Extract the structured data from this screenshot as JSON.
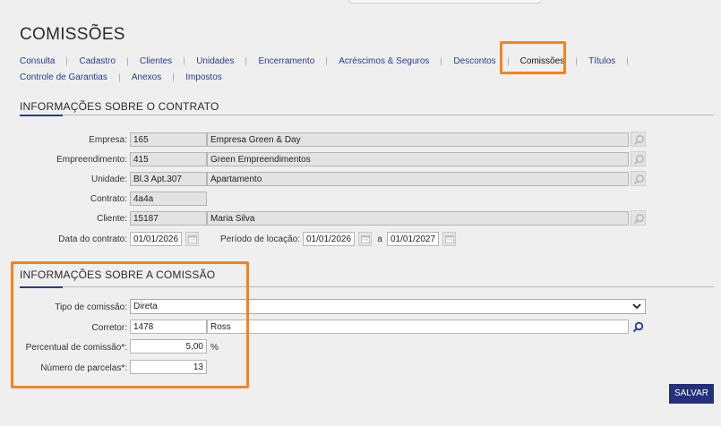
{
  "page": {
    "title": "COMISSÕES"
  },
  "tabs": {
    "row1": [
      "Consulta",
      "Cadastro",
      "Clientes",
      "Unidades",
      "Encerramento",
      "Acréscimos & Seguros",
      "Descontos",
      "Comissões",
      "Títulos"
    ],
    "row2": [
      "Controle de Garantias",
      "Anexos",
      "Impostos"
    ],
    "active": "Comissões"
  },
  "contract": {
    "title": "INFORMAÇÕES SOBRE O CONTRATO",
    "empresa": {
      "label": "Empresa:",
      "code": "165",
      "name": "Empresa Green & Day"
    },
    "empreendimento": {
      "label": "Empreendimento:",
      "code": "415",
      "name": "Green Empreendimentos"
    },
    "unidade": {
      "label": "Unidade:",
      "code": "Bl.3 Apt.307",
      "name": "Apartamento"
    },
    "contrato": {
      "label": "Contrato:",
      "code": "4a4a"
    },
    "cliente": {
      "label": "Cliente:",
      "code": "15187",
      "name": "Maria Silva"
    },
    "data_contrato": {
      "label": "Data do contrato:",
      "value": "01/01/2026"
    },
    "periodo": {
      "label": "Período de locação:",
      "start": "01/01/2026",
      "sep": "a",
      "end": "01/01/2027"
    }
  },
  "commission": {
    "title": "INFORMAÇÕES SOBRE A COMISSÃO",
    "tipo": {
      "label": "Tipo de comissão:",
      "value": "Direta"
    },
    "corretor": {
      "label": "Corretor:",
      "code": "1478",
      "name": "Ross"
    },
    "percentual": {
      "label": "Percentual de comissão*:",
      "value": "5,00",
      "unit": "%"
    },
    "parcelas": {
      "label": "Número de parcelas*:",
      "value": "13"
    }
  },
  "actions": {
    "save_label": "SALVAR"
  },
  "colors": {
    "accent": "#2b3b8f",
    "highlight": "#f5821f",
    "button": "#25307a"
  }
}
